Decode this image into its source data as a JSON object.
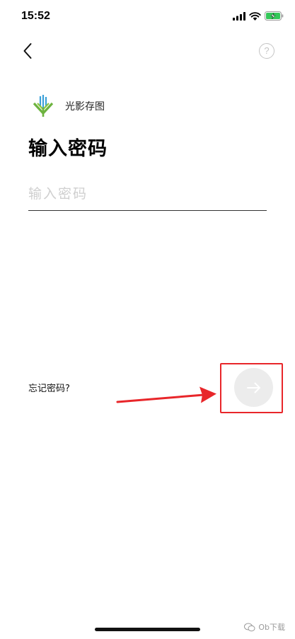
{
  "status_bar": {
    "time": "15:52",
    "icons": [
      "signal-icon",
      "wifi-icon",
      "battery-charging-icon"
    ],
    "battery_color": "#34c759"
  },
  "nav": {
    "back_icon": "chevron-left-icon",
    "help_label": "?"
  },
  "brand": {
    "name": "光影存图",
    "logo_colors": [
      "#6db33f",
      "#3aa0d8"
    ]
  },
  "title": "输入密码",
  "password_field": {
    "placeholder": "输入密码",
    "value": ""
  },
  "forgot_password_label": "忘记密码?",
  "next_button": {
    "icon": "arrow-right-icon",
    "background": "#ececec"
  },
  "annotation": {
    "color": "#e8262a"
  },
  "watermark": {
    "text": "Ob下载"
  }
}
